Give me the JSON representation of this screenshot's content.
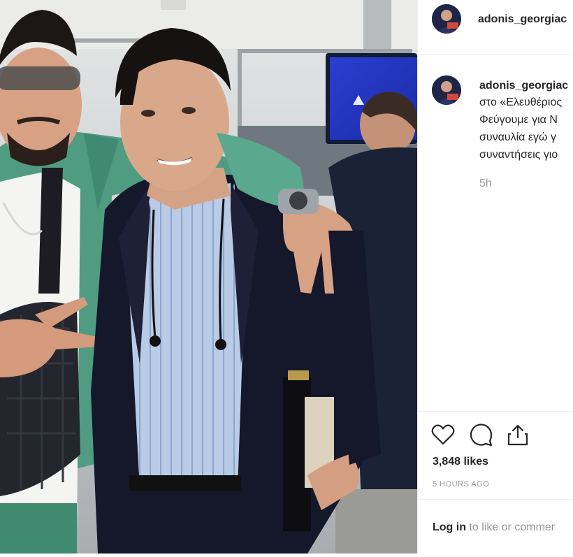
{
  "post": {
    "username": "adonis_georgiac",
    "caption_lines": [
      "στο «Ελευθέριος",
      "Φεύγουμε για Ν",
      "συναυλία εγώ γ",
      "συναντήσεις γιο"
    ],
    "timestamp": "5h",
    "likes": "3,848 likes",
    "time_ago": "5 HOURS AGO",
    "login_link": "Log in",
    "login_rest": " to like or commer"
  },
  "colors": {
    "text": "#262626",
    "muted": "#999999",
    "divider": "#efefef"
  },
  "icons": {
    "like": "heart-icon",
    "comment": "comment-bubble-icon",
    "share": "share-upload-icon"
  }
}
